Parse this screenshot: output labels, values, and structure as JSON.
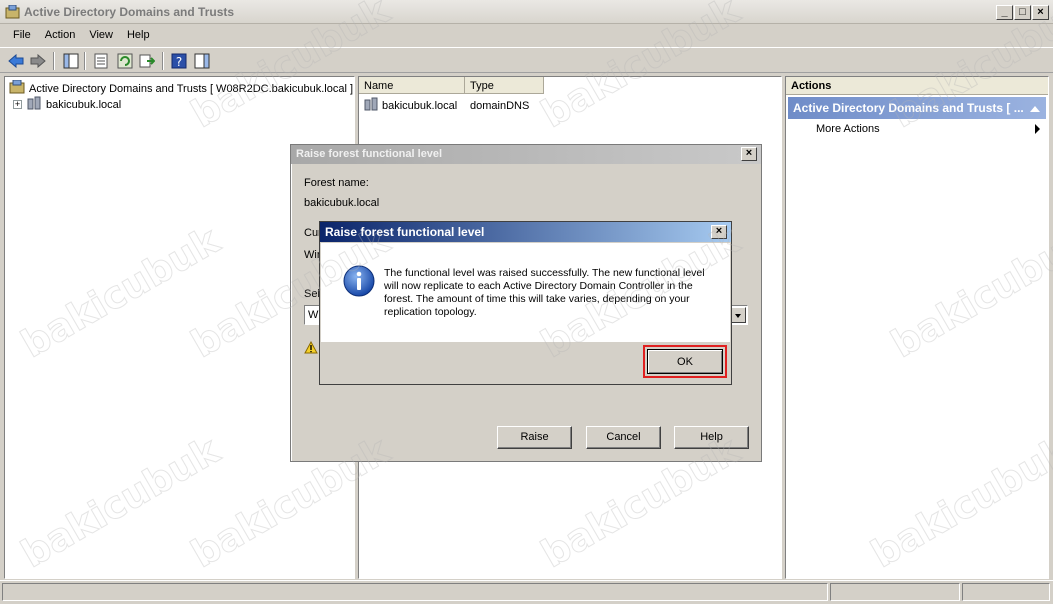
{
  "window": {
    "title": "Active Directory Domains and Trusts",
    "controls": {
      "minimize": "_",
      "maximize": "□",
      "close": "×"
    }
  },
  "menu": [
    "File",
    "Action",
    "View",
    "Help"
  ],
  "tree": {
    "root": "Active Directory Domains and Trusts [ W08R2DC.bakicubuk.local ]",
    "children": [
      {
        "label": "bakicubuk.local",
        "expander": "+"
      }
    ]
  },
  "list": {
    "columns": [
      "Name",
      "Type"
    ],
    "rows": [
      {
        "name": "bakicubuk.local",
        "type": "domainDNS"
      }
    ]
  },
  "actions": {
    "title": "Actions",
    "group": "Active Directory Domains and Trusts [ ...",
    "items": [
      "More Actions"
    ]
  },
  "dialog_back": {
    "title": "Raise forest functional level",
    "forest_name_label": "Forest name:",
    "forest_name_value": "bakicubuk.local",
    "current_label_partial": "Cur",
    "current_value_partial": "Win",
    "select_label_partial": "Sel",
    "combo_value_partial": "W",
    "buttons": {
      "raise": "Raise",
      "cancel": "Cancel",
      "help": "Help"
    }
  },
  "dialog_front": {
    "title": "Raise forest functional level",
    "message": "The functional level was raised successfully. The new functional level will now replicate to each Active Directory Domain Controller in the forest. The amount of time this will take varies, depending on your replication topology.",
    "ok_label": "OK",
    "close": "×"
  },
  "watermark": "bakicubuk",
  "colors": {
    "accent_title": "#0a246a",
    "highlight_border": "#e02020",
    "actions_group": "#6f8cc8"
  }
}
